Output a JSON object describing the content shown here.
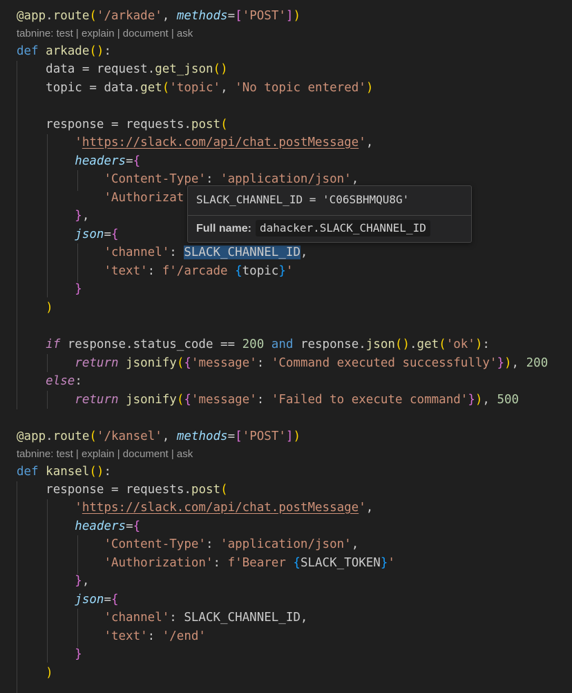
{
  "codelens": {
    "prefix": "tabnine:",
    "items": [
      "test",
      "explain",
      "document",
      "ask"
    ],
    "separator": "|"
  },
  "hover": {
    "signature": "SLACK_CHANNEL_ID = 'C06SBHMQU8G'",
    "full_name_label": "Full name:",
    "full_name_value": "dahacker.SLACK_CHANNEL_ID"
  },
  "code": {
    "route1": {
      "at": "@app",
      "dot": ".",
      "route": "route",
      "path": "'/arkade'",
      "comma": ", ",
      "methods": "methods",
      "eq": "=",
      "post": "'POST'"
    },
    "func1": {
      "def": "def",
      "name": "arkade",
      "parens": "()",
      "colon": ":"
    },
    "l_data": {
      "var": "data",
      "eq": " = ",
      "obj": "request",
      "dot": ".",
      "call": "get_json",
      "parens": "()"
    },
    "l_topic": {
      "var": "topic",
      "eq": " = ",
      "obj": "data",
      "dot": ".",
      "call": "get",
      "arg1": "'topic'",
      "comma": ", ",
      "arg2": "'No topic entered'"
    },
    "l_resp": {
      "var": "response",
      "eq": " = ",
      "obj": "requests",
      "dot": ".",
      "call": "post"
    },
    "url": {
      "q1": "'",
      "text": "https://slack.com/api/chat.postMessage",
      "q2": "'",
      "comma": ","
    },
    "headers": "headers",
    "json_kw": "json",
    "eq": "=",
    "content_type_key": "'Content-Type'",
    "content_type_val": "'application/json'",
    "authorization_key_partial": "'Authorizat",
    "authorization_key": "'Authorization'",
    "bearer_prefix": "f'Bearer ",
    "slack_token": "SLACK_TOKEN",
    "bearer_suffix": "'",
    "channel_key": "'channel'",
    "channel_var": "SLACK_CHANNEL_ID",
    "text_key": "'text'",
    "arcade_prefix": "f'/arcade ",
    "topic_var": "topic",
    "arcade_suffix": "'",
    "end_text": "'/end'",
    "colon_sp": ": ",
    "comma": ",",
    "if_kw": "if",
    "status": " response.status_code == ",
    "n200": "200",
    "and_kw": "and",
    "resp_obj": " response.",
    "json_call": "json",
    "get_call": "get",
    "ok_str": "'ok'",
    "return_kw": "return",
    "jsonify": "jsonify",
    "message_key": "'message'",
    "success_msg": "'Command executed successfully'",
    "n500": "500",
    "fail_msg": "'Failed to execute command'",
    "else_kw": "else",
    "route2": {
      "path": "'/kansel'"
    },
    "func2": {
      "name": "kansel"
    }
  }
}
